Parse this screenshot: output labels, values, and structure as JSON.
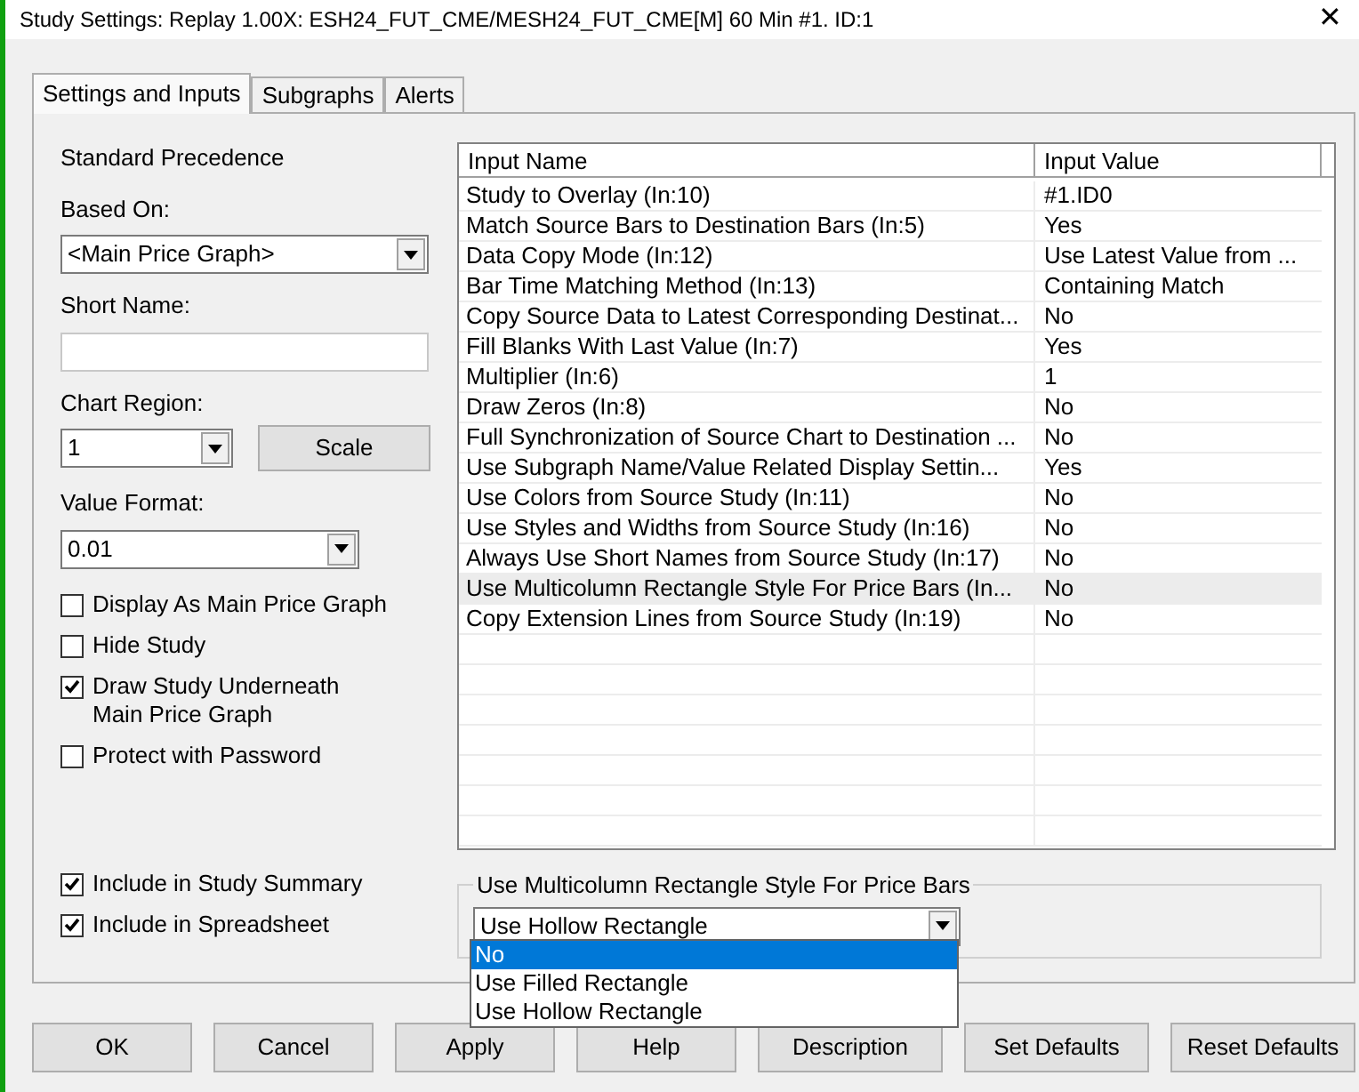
{
  "window": {
    "title": "Study Settings: Replay 1.00X: ESH24_FUT_CME/MESH24_FUT_CME[M]  60 Min  #1. ID:1",
    "close": "✕"
  },
  "tabs": [
    {
      "label": "Settings and Inputs",
      "selected": true
    },
    {
      "label": "Subgraphs",
      "selected": false
    },
    {
      "label": "Alerts",
      "selected": false
    }
  ],
  "settings": {
    "precedence": "Standard Precedence",
    "based_on": {
      "label": "Based On:",
      "value": "<Main Price Graph>"
    },
    "short_name": {
      "label": "Short Name:"
    },
    "chart_region": {
      "label": "Chart Region:",
      "value": "1"
    },
    "scale_button": "Scale",
    "value_format": {
      "label": "Value Format:",
      "value": "0.01"
    },
    "options": [
      {
        "label": "Display As Main Price Graph",
        "checked": false
      },
      {
        "label": "Hide Study",
        "checked": false
      },
      {
        "label": "Draw Study Underneath Main Price Graph",
        "checked": true
      },
      {
        "label": "Protect with Password",
        "checked": false
      }
    ],
    "summary_options": [
      {
        "label": "Include in Study Summary",
        "checked": true
      },
      {
        "label": "Include in Spreadsheet",
        "checked": true
      }
    ]
  },
  "inputs_table": {
    "columns": [
      "Input Name",
      "Input Value"
    ],
    "rows": [
      {
        "name": "Study to Overlay   (In:10)",
        "value": "#1.ID0",
        "selected": false
      },
      {
        "name": "Match Source Bars to Destination Bars   (In:5)",
        "value": "Yes",
        "selected": false
      },
      {
        "name": "Data Copy Mode   (In:12)",
        "value": "Use Latest Value from ...",
        "selected": false
      },
      {
        "name": "Bar Time Matching Method   (In:13)",
        "value": "Containing Match",
        "selected": false
      },
      {
        "name": "Copy Source Data to Latest Corresponding Destinat...",
        "value": "No",
        "selected": false
      },
      {
        "name": "Fill Blanks With Last Value   (In:7)",
        "value": "Yes",
        "selected": false
      },
      {
        "name": "Multiplier   (In:6)",
        "value": "1",
        "selected": false
      },
      {
        "name": "Draw Zeros   (In:8)",
        "value": "No",
        "selected": false
      },
      {
        "name": "Full Synchronization of Source Chart to Destination   ...",
        "value": "No",
        "selected": false
      },
      {
        "name": "Use Subgraph Name/Value Related Display Settin...",
        "value": "Yes",
        "selected": false
      },
      {
        "name": "Use Colors from Source Study   (In:11)",
        "value": "No",
        "selected": false
      },
      {
        "name": "Use Styles and Widths from Source Study   (In:16)",
        "value": "No",
        "selected": false
      },
      {
        "name": "Always Use Short Names from Source Study   (In:17)",
        "value": "No",
        "selected": false
      },
      {
        "name": "Use Multicolumn Rectangle Style For Price Bars   (In...",
        "value": "No",
        "selected": true
      },
      {
        "name": "Copy Extension Lines from Source Study   (In:19)",
        "value": "No",
        "selected": false
      }
    ]
  },
  "input_editor": {
    "title": "Use Multicolumn Rectangle Style For Price Bars",
    "value": "Use Hollow Rectangle",
    "options": [
      {
        "label": "No",
        "highlighted": true
      },
      {
        "label": "Use Filled Rectangle",
        "highlighted": false
      },
      {
        "label": "Use Hollow Rectangle",
        "highlighted": false
      }
    ]
  },
  "buttons": [
    "OK",
    "Cancel",
    "Apply",
    "Help",
    "Description",
    "Set Defaults",
    "Reset Defaults"
  ]
}
